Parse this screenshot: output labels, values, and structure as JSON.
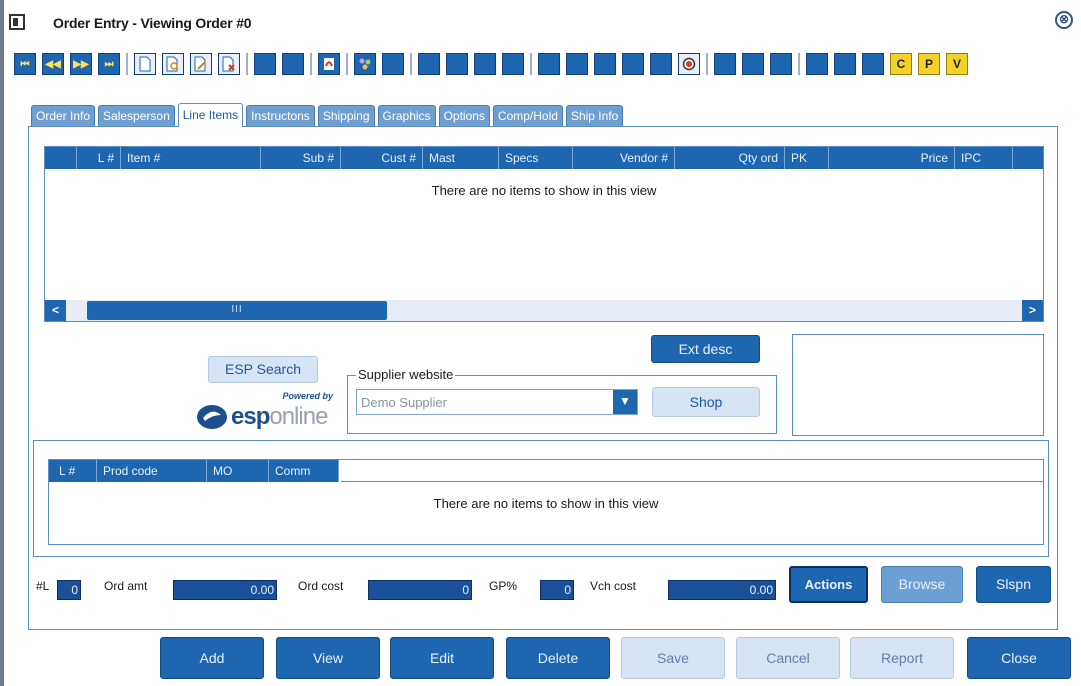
{
  "window": {
    "title": "Order Entry - Viewing Order #0",
    "close_glyph": "⊗"
  },
  "toolbar": {
    "buttons": [
      {
        "icon": "first-record-icon",
        "glyph": "⏮"
      },
      {
        "icon": "previous-record-icon",
        "glyph": "◀◀"
      },
      {
        "icon": "next-record-icon",
        "glyph": "▶▶"
      },
      {
        "icon": "last-record-icon",
        "glyph": "⏭"
      },
      {
        "icon": "new-document-icon"
      },
      {
        "icon": "find-document-icon"
      },
      {
        "icon": "edit-document-icon"
      },
      {
        "icon": "delete-document-icon"
      },
      {
        "icon": "tool-button-icon"
      },
      {
        "icon": "tool-button-icon"
      },
      {
        "icon": "pdf-icon"
      },
      {
        "icon": "network-icon"
      },
      {
        "icon": "tool-button-icon"
      },
      {
        "icon": "tool-button-icon"
      },
      {
        "icon": "tool-button-icon"
      },
      {
        "icon": "tool-button-icon"
      },
      {
        "icon": "tool-button-icon"
      },
      {
        "icon": "tool-button-icon"
      },
      {
        "icon": "tool-button-icon"
      },
      {
        "icon": "tool-button-icon"
      },
      {
        "icon": "tool-button-icon"
      },
      {
        "icon": "record-icon"
      },
      {
        "icon": "tool-button-icon"
      },
      {
        "icon": "tool-button-icon"
      },
      {
        "icon": "tool-button-icon"
      },
      {
        "icon": "tool-button-icon"
      },
      {
        "icon": "tool-button-icon"
      },
      {
        "icon": "tool-button-icon"
      },
      {
        "icon": "c-letter-icon",
        "label": "C"
      },
      {
        "icon": "p-letter-icon",
        "label": "P"
      },
      {
        "icon": "v-letter-icon",
        "label": "V"
      }
    ]
  },
  "tabs": [
    "Order Info",
    "Salesperson",
    "Line Items",
    "Instructons",
    "Shipping",
    "Graphics",
    "Options",
    "Comp/Hold",
    "Ship Info"
  ],
  "active_tab": "Line Items",
  "line_items_grid": {
    "columns": [
      "",
      "L #",
      "Item #",
      "Sub #",
      "Cust #",
      "Mast",
      "Specs",
      "Vendor #",
      "Qty ord",
      "PK",
      "Price",
      "IPC"
    ],
    "empty_message": "There are no items to show in this view",
    "scroll_thumb_glyph": "III",
    "scroll_left_glyph": "<",
    "scroll_right_glyph": ">"
  },
  "esp": {
    "search_label": "ESP Search",
    "powered_by": "Powered by",
    "logo_esp": "esp",
    "logo_online": "online"
  },
  "supplier": {
    "legend": "Supplier website",
    "selected": "Demo Supplier",
    "shop_label": "Shop",
    "ext_desc_label": "Ext desc"
  },
  "comments_grid": {
    "columns": [
      "L #",
      "Prod code",
      "MO",
      "Comm"
    ],
    "empty_message": "There are no items to show in this view"
  },
  "status": {
    "line_count_label": "#L",
    "line_count_value": "0",
    "ord_amt_label": "Ord amt",
    "ord_amt_value": "0.00",
    "ord_cost_label": "Ord cost",
    "ord_cost_value": "0",
    "gp_label": "GP%",
    "gp_value": "0",
    "vch_cost_label": "Vch cost",
    "vch_cost_value": "0.00",
    "actions_label": "Actions",
    "browse_label": "Browse",
    "slspn_label": "Slspn"
  },
  "bottom_buttons": [
    {
      "label": "Add",
      "enabled": true
    },
    {
      "label": "View",
      "enabled": true
    },
    {
      "label": "Edit",
      "enabled": true
    },
    {
      "label": "Delete",
      "enabled": true
    },
    {
      "label": "Save",
      "enabled": false
    },
    {
      "label": "Cancel",
      "enabled": false
    },
    {
      "label": "Report",
      "enabled": false
    },
    {
      "label": "Close",
      "enabled": true
    }
  ],
  "colors": {
    "accent": "#1e66b0",
    "tab_inactive": "#6e9fd0",
    "button_disabled": "#d6e4f3",
    "field_dark": "#1a4f99"
  }
}
